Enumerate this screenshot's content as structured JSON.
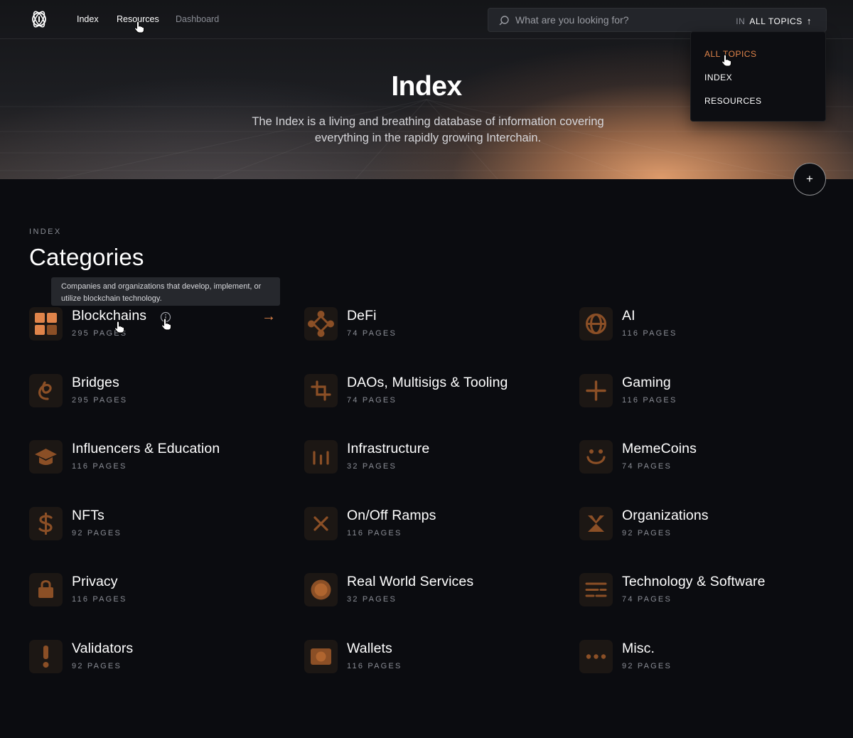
{
  "nav": {
    "links": [
      "Index",
      "Resources",
      "Dashboard"
    ]
  },
  "search": {
    "placeholder": "What are you looking for?",
    "scope_prefix": "IN",
    "scope_value": "ALL TOPICS"
  },
  "dropdown": {
    "options": [
      "ALL TOPICS",
      "INDEX",
      "RESOURCES"
    ],
    "selected": "ALL TOPICS"
  },
  "hero": {
    "title": "Index",
    "subtitle": "The Index is a living and breathing database of information covering everything in the rapidly growing Interchain."
  },
  "section": {
    "eyebrow": "INDEX",
    "title": "Categories"
  },
  "tooltip": {
    "text": "Companies and organizations that develop, implement, or utilize blockchain technology."
  },
  "categories": [
    {
      "name": "Blockchains",
      "pages": "295 PAGES",
      "icon": "blocks-grid-icon"
    },
    {
      "name": "DeFi",
      "pages": "74 PAGES",
      "icon": "defi-nodes-icon"
    },
    {
      "name": "AI",
      "pages": "116 PAGES",
      "icon": "ai-orbit-icon"
    },
    {
      "name": "Bridges",
      "pages": "295 PAGES",
      "icon": "bridge-loop-icon"
    },
    {
      "name": "DAOs, Multisigs & Tooling",
      "pages": "74 PAGES",
      "icon": "crop-tool-icon"
    },
    {
      "name": "Gaming",
      "pages": "116 PAGES",
      "icon": "plus-cross-icon"
    },
    {
      "name": "Influencers & Education",
      "pages": "116 PAGES",
      "icon": "graduation-cap-icon"
    },
    {
      "name": "Infrastructure",
      "pages": "32 PAGES",
      "icon": "bars-icon"
    },
    {
      "name": "MemeCoins",
      "pages": "74 PAGES",
      "icon": "smiley-icon"
    },
    {
      "name": "NFTs",
      "pages": "92 PAGES",
      "icon": "dollar-icon"
    },
    {
      "name": "On/Off Ramps",
      "pages": "116 PAGES",
      "icon": "x-icon"
    },
    {
      "name": "Organizations",
      "pages": "92 PAGES",
      "icon": "hourglass-icon"
    },
    {
      "name": "Privacy",
      "pages": "116 PAGES",
      "icon": "lock-icon"
    },
    {
      "name": "Real World Services",
      "pages": "32 PAGES",
      "icon": "circle-icon"
    },
    {
      "name": "Technology & Software",
      "pages": "74 PAGES",
      "icon": "text-lines-icon"
    },
    {
      "name": "Validators",
      "pages": "92 PAGES",
      "icon": "exclamation-icon"
    },
    {
      "name": "Wallets",
      "pages": "116 PAGES",
      "icon": "wallet-icon"
    },
    {
      "name": "Misc.",
      "pages": "92 PAGES",
      "icon": "dots-icon"
    }
  ],
  "colors": {
    "accent": "#e0844a",
    "icon_dark": "#8b4f26",
    "tile_bg": "#1c1714",
    "page_bg": "#0b0c10"
  }
}
